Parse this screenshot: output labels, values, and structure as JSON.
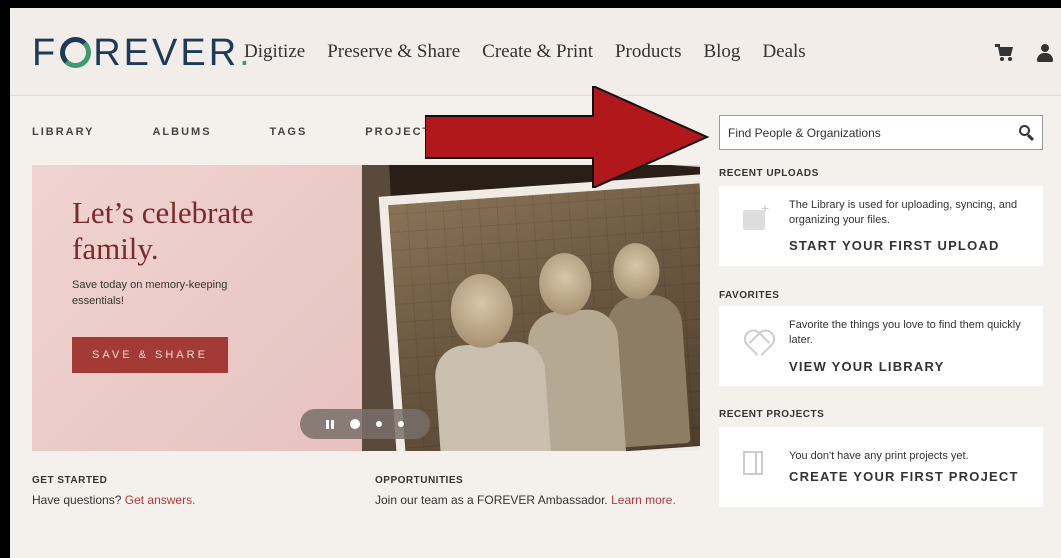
{
  "logo": {
    "pre": "F",
    "post": "REVER",
    "dot": "."
  },
  "nav": [
    "Digitize",
    "Preserve & Share",
    "Create & Print",
    "Products",
    "Blog",
    "Deals"
  ],
  "tabs": [
    "LIBRARY",
    "ALBUMS",
    "TAGS",
    "PROJECTS"
  ],
  "hero": {
    "title": "Let’s celebrate family.",
    "subtitle": "Save today on memory-keeping essentials!",
    "button": "SAVE & SHARE"
  },
  "get_started": {
    "heading": "GET STARTED",
    "text": "Have questions? ",
    "link": "Get answers."
  },
  "opportunities": {
    "heading": "OPPORTUNITIES",
    "text": "Join our team as a FOREVER Ambassador. ",
    "link": "Learn more."
  },
  "search": {
    "placeholder": "Find People & Organizations"
  },
  "recent_uploads": {
    "heading": "RECENT UPLOADS",
    "desc": "The Library is used for uploading, syncing, and organizing your files.",
    "cta": "START YOUR FIRST UPLOAD"
  },
  "favorites": {
    "heading": "FAVORITES",
    "desc": "Favorite the things you love to find them quickly later.",
    "cta": "VIEW YOUR LIBRARY"
  },
  "recent_projects": {
    "heading": "RECENT PROJECTS",
    "desc": "You don't have any print projects yet.",
    "cta": "CREATE YOUR FIRST PROJECT"
  },
  "colors": {
    "brand_navy": "#1c3a5a",
    "brand_green": "#3f9a6e",
    "accent_red": "#a33a36",
    "annotation_red": "#b0181c"
  },
  "icons": [
    "cart-icon",
    "user-icon",
    "search-icon",
    "pause-icon",
    "upload-icon",
    "heart-icon",
    "project-icon"
  ]
}
